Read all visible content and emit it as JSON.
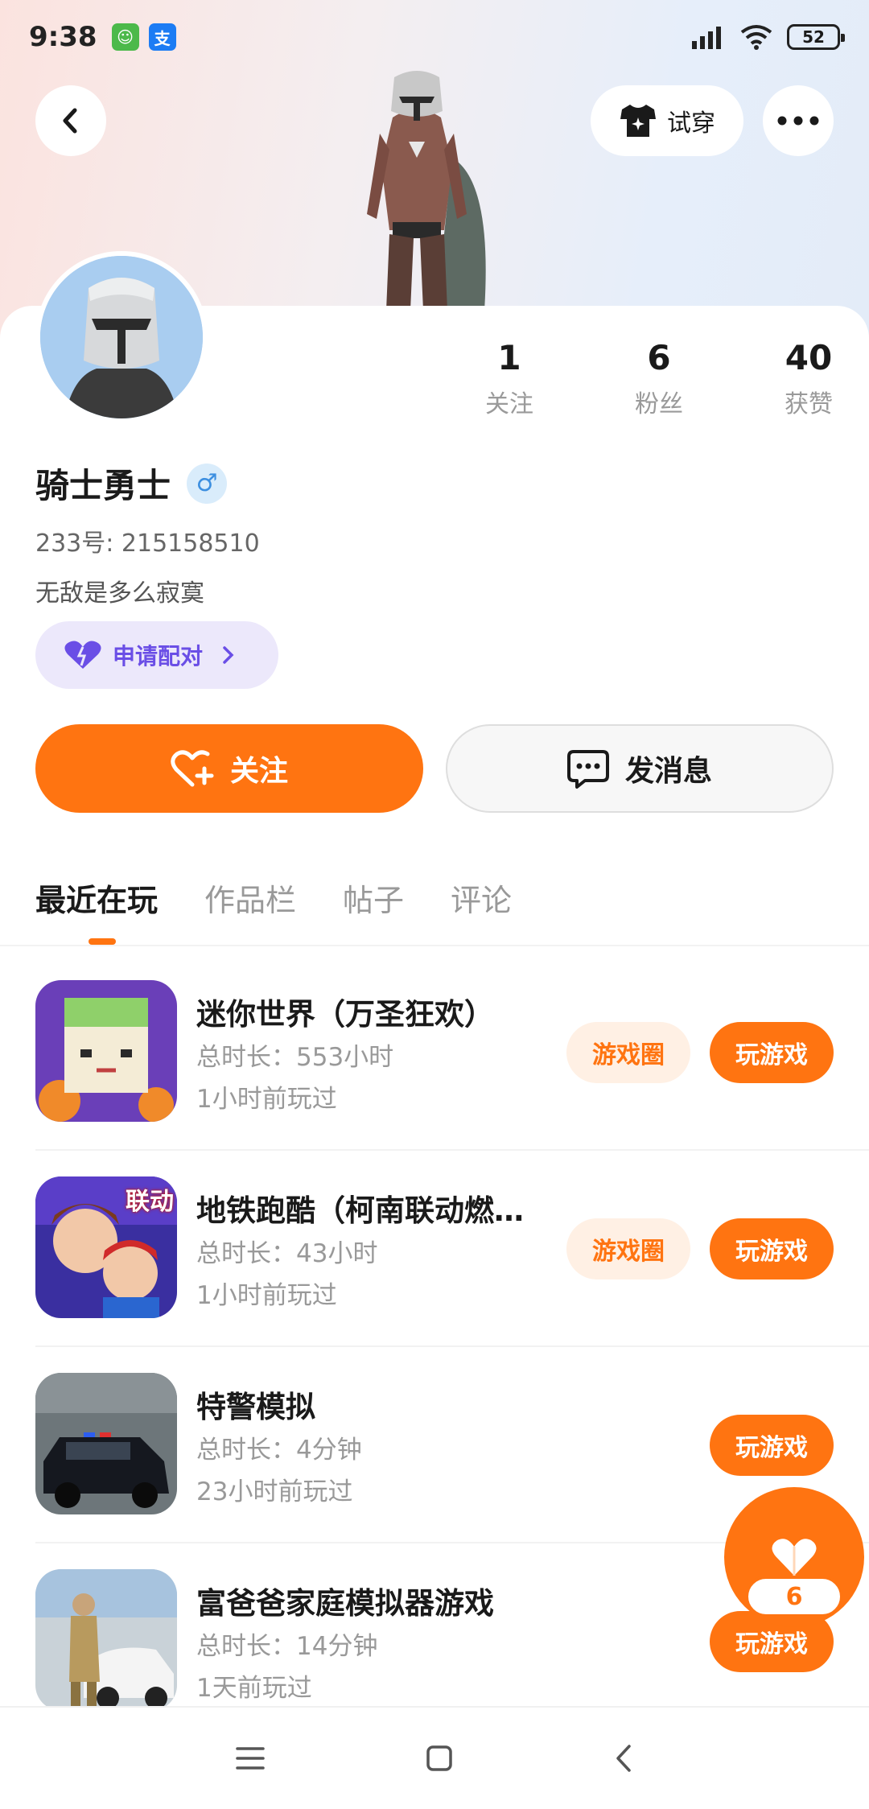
{
  "status_bar": {
    "time": "9:38",
    "battery": "52"
  },
  "header": {
    "try_on_label": "试穿"
  },
  "profile": {
    "username": "骑士勇士",
    "gender_symbol": "♂",
    "uid": "233号: 215158510",
    "bio": "无敌是多么寂寞",
    "match_label": "申请配对",
    "stats": [
      {
        "num": "1",
        "label": "关注"
      },
      {
        "num": "6",
        "label": "粉丝"
      },
      {
        "num": "40",
        "label": "获赞"
      }
    ]
  },
  "actions": {
    "follow_label": "关注",
    "message_label": "发消息"
  },
  "tabs": [
    {
      "label": "最近在玩",
      "active": true
    },
    {
      "label": "作品栏",
      "active": false
    },
    {
      "label": "帖子",
      "active": false
    },
    {
      "label": "评论",
      "active": false
    }
  ],
  "games": [
    {
      "name": "迷你世界（万圣狂欢）",
      "duration": "总时长：553小时",
      "last_played": "1小时前玩过",
      "circle_label": "游戏圈",
      "play_label": "玩游戏"
    },
    {
      "name": "地铁跑酷（柯南联动燃…",
      "duration": "总时长：43小时",
      "last_played": "1小时前玩过",
      "circle_label": "游戏圈",
      "play_label": "玩游戏",
      "icon_badge": "联动"
    },
    {
      "name": "特警模拟",
      "duration": "总时长：4分钟",
      "last_played": "23小时前玩过",
      "play_label": "玩游戏"
    },
    {
      "name": "富爸爸家庭模拟器游戏",
      "duration": "总时长：14分钟",
      "last_played": "1天前玩过",
      "play_label": "玩游戏"
    }
  ],
  "fab": {
    "count": "6"
  },
  "colors": {
    "accent": "#ff7411",
    "match": "#6a4ee6"
  },
  "icons": [
    "back-icon",
    "tshirt-icon",
    "more-icon",
    "heart-plus-icon",
    "chat-icon",
    "heart-icon",
    "menu-icon",
    "home-icon",
    "nav-back-icon"
  ]
}
